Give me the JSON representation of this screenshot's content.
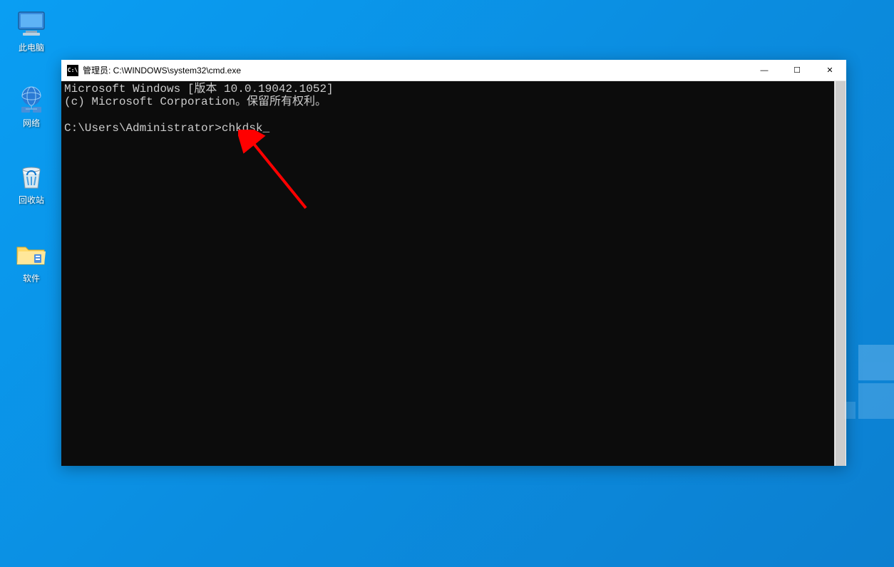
{
  "desktop": {
    "icons": [
      {
        "label": "此电脑",
        "name": "this-pc"
      },
      {
        "label": "网络",
        "name": "network"
      },
      {
        "label": "回收站",
        "name": "recycle-bin"
      },
      {
        "label": "软件",
        "name": "software-folder"
      }
    ]
  },
  "window": {
    "title": "管理员: C:\\WINDOWS\\system32\\cmd.exe",
    "controls": {
      "minimize": "—",
      "maximize": "☐",
      "close": "✕"
    }
  },
  "terminal": {
    "line1": "Microsoft Windows [版本 10.0.19042.1052]",
    "line2": "(c) Microsoft Corporation。保留所有权利。",
    "prompt": "C:\\Users\\Administrator>",
    "command": "chkdsk",
    "cursor": "_"
  }
}
